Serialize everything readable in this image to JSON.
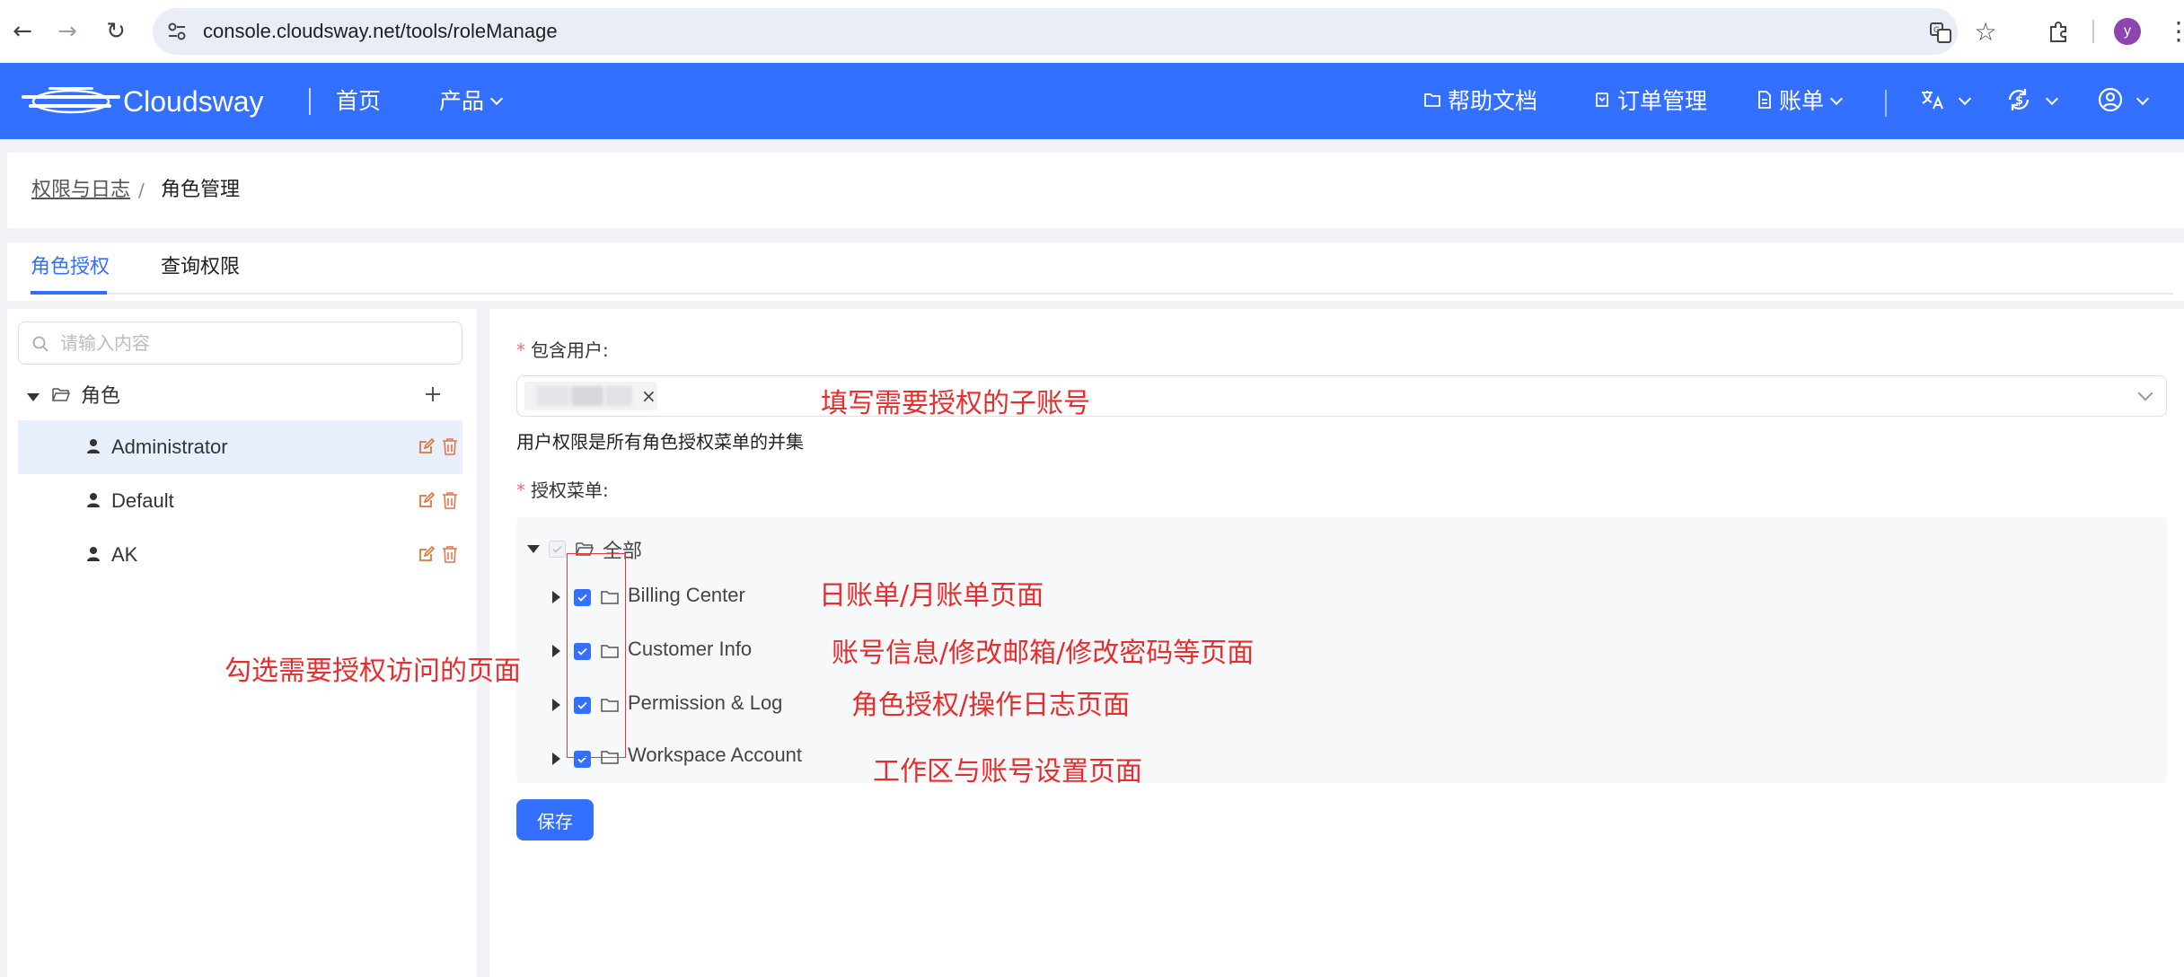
{
  "browser": {
    "url": "console.cloudsway.net/tools/roleManage",
    "profile_initial": "y"
  },
  "header": {
    "brand": "Cloudsway",
    "nav_home": "首页",
    "nav_products": "产品",
    "help_docs": "帮助文档",
    "order_mgmt": "订单管理",
    "billing": "账单"
  },
  "breadcrumb": {
    "parent": "权限与日志",
    "separator": "/",
    "current": "角色管理"
  },
  "tabs": {
    "role_auth": "角色授权",
    "query_perm": "查询权限"
  },
  "sidebar": {
    "search_placeholder": "请输入内容",
    "root_label": "角色",
    "roles": [
      {
        "label": "Administrator",
        "selected": true
      },
      {
        "label": "Default",
        "selected": false
      },
      {
        "label": "AK",
        "selected": false
      }
    ]
  },
  "form": {
    "users_label": "包含用户:",
    "required_mark": "*",
    "hint": "用户权限是所有角色授权菜单的并集",
    "menu_label": "授权菜单:",
    "menu_root": "全部",
    "menu_items": [
      {
        "label": "Billing Center",
        "checked": true
      },
      {
        "label": "Customer Info",
        "checked": true
      },
      {
        "label": "Permission & Log",
        "checked": true
      },
      {
        "label": "Workspace Account",
        "checked": true
      }
    ],
    "save_label": "保存"
  },
  "annotations": {
    "user_select": "填写需要授权的子账号",
    "billing": "日账单/月账单页面",
    "customer": "账号信息/修改邮箱/修改密码等页面",
    "checkbox_hint": "勾选需要授权访问的页面",
    "permission": "角色授权/操作日志页面",
    "workspace": "工作区与账号设置页面"
  },
  "colors": {
    "brand": "#3370ff",
    "annotation": "#e62e2e",
    "danger_icon": "#e6734c"
  }
}
